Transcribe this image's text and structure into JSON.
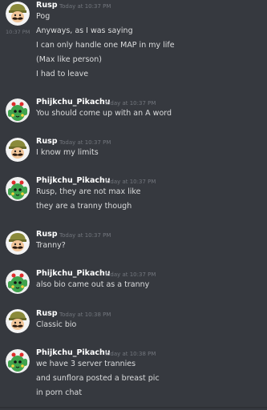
{
  "hover_timestamp": "10:37 PM",
  "messages": [
    {
      "user": "Rusp",
      "time": "Today at 10:37 PM",
      "lines": [
        "Pog",
        "Anyways, as I was saying",
        "I can only handle one MAP in my life",
        "(Max like person)",
        "I had to leave"
      ]
    },
    {
      "user": "Phijkchu_Pikachu",
      "time": "Today at 10:37 PM",
      "lines": [
        "You should come up with an A word"
      ]
    },
    {
      "user": "Rusp",
      "time": "Today at 10:37 PM",
      "lines": [
        "I know my limits"
      ]
    },
    {
      "user": "Phijkchu_Pikachu",
      "time": "Today at 10:37 PM",
      "lines": [
        "Rusp, they are not max like",
        "they are a tranny though"
      ]
    },
    {
      "user": "Rusp",
      "time": "Today at 10:37 PM",
      "lines": [
        "Tranny?"
      ]
    },
    {
      "user": "Phijkchu_Pikachu",
      "time": "Today at 10:37 PM",
      "lines": [
        "also bio came out as a tranny"
      ]
    },
    {
      "user": "Rusp",
      "time": "Today at 10:38 PM",
      "lines": [
        "Classic bio"
      ]
    },
    {
      "user": "Phijkchu_Pikachu",
      "time": "Today at 10:38 PM",
      "lines": [
        "we have 3 server trannies",
        "and sunflora posted a breast pic",
        "in porn chat"
      ]
    }
  ],
  "colors": {
    "background": "#36393f",
    "username": "#ffffff",
    "message_text": "#dcddde",
    "timestamp": "#72767d"
  },
  "avatars": {
    "rusp": "mustache-man-cap-avatar",
    "phijkchu": "green-cactus-pikachu-avatar"
  }
}
